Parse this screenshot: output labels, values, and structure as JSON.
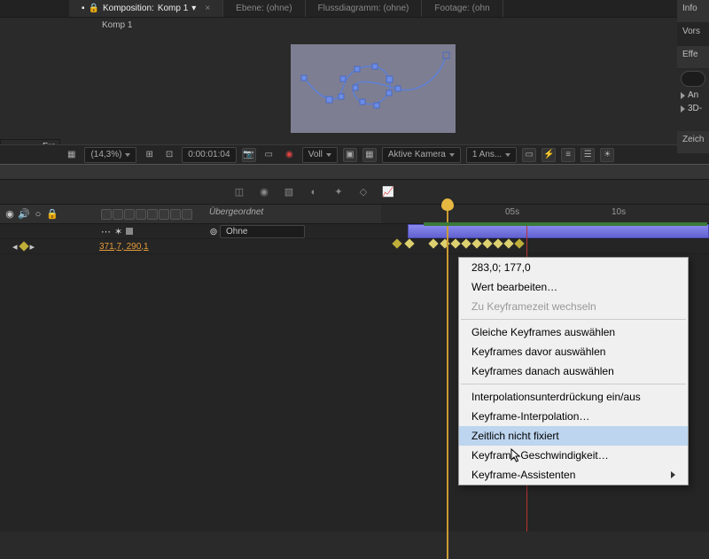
{
  "tabs": {
    "comp_prefix": "Komposition:",
    "comp_name": "Komp 1",
    "layer": "Ebene: (ohne)",
    "flowchart": "Flussdiagramm: (ohne)",
    "footage": "Footage: (ohn"
  },
  "breadcrumb": "Komp 1",
  "side_panels": {
    "info": "Info",
    "vors": "Vors",
    "eff": "Effe",
    "an": "An",
    "d3": "3D-",
    "zeich": "Zeich"
  },
  "viewer_controls": {
    "zoom": "(14,3%)",
    "timecode": "0:00:01:04",
    "resolution": "Voll",
    "camera": "Aktive Kamera",
    "views": "1 Ans..."
  },
  "left_panel_label": "Fra",
  "timeline": {
    "header_parent": "Übergeordnet",
    "parent_dropdown": "Ohne",
    "time_05": "05s",
    "time_10": "10s",
    "property_value": "371,7, 290,1"
  },
  "context_menu": {
    "value": "283,0; 177,0",
    "edit_value": "Wert bearbeiten…",
    "goto_time": "Zu Keyframezeit wechseln",
    "select_same": "Gleiche Keyframes auswählen",
    "select_before": "Keyframes davor auswählen",
    "select_after": "Keyframes danach auswählen",
    "interp_toggle": "Interpolationsunterdrückung ein/aus",
    "keyframe_interp": "Keyframe-Interpolation…",
    "rove": "Zeitlich nicht fixiert",
    "velocity": "Keyframe-Geschwindigkeit…",
    "assistants": "Keyframe-Assistenten"
  }
}
